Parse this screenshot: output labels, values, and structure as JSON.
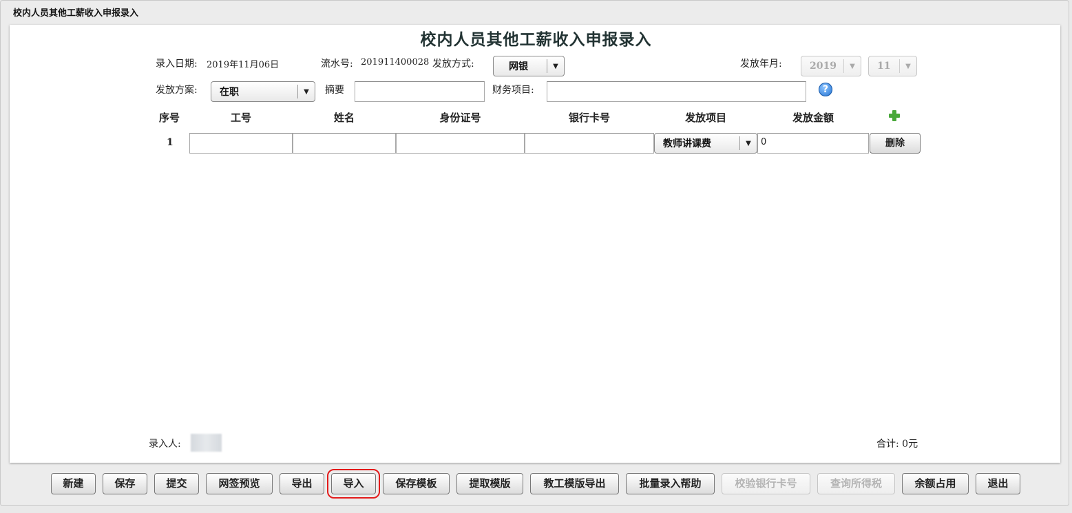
{
  "window": {
    "title": "校内人员其他工薪收入申报录入"
  },
  "page": {
    "title": "校内人员其他工薪收入申报录入"
  },
  "form": {
    "entry_date_label": "录入日期:",
    "entry_date_value": "2019年11月06日",
    "serial_label": "流水号:",
    "serial_value": "201911400028",
    "payment_method_label": "发放方式:",
    "payment_method_value": "网银",
    "pay_period_label": "发放年月:",
    "pay_year_value": "2019",
    "pay_month_value": "11",
    "plan_label": "发放方案:",
    "plan_value": "在职",
    "summary_label": "摘要",
    "summary_value": "",
    "finance_label": "财务项目:",
    "finance_value": ""
  },
  "table": {
    "headers": [
      "序号",
      "工号",
      "姓名",
      "身份证号",
      "银行卡号",
      "发放项目",
      "发放金额"
    ],
    "rows": [
      {
        "index": "1",
        "staff_id": "",
        "name": "",
        "id_card": "",
        "bank_card": "",
        "item": "教师讲课费",
        "amount": "0",
        "delete_label": "删除"
      }
    ]
  },
  "footer": {
    "entered_by_label": "录入人:",
    "total_label": "合计: 0元"
  },
  "toolbar": {
    "buttons": [
      "新建",
      "保存",
      "提交",
      "网签预览",
      "导出",
      "导入",
      "保存模板",
      "提取模版",
      "教工模版导出",
      "批量录入帮助",
      "校验银行卡号",
      "查询所得税",
      "余额占用",
      "退出"
    ],
    "disabled": [
      "校验银行卡号",
      "查询所得税"
    ],
    "highlighted": "导入"
  },
  "colors": {
    "highlight_outline": "#e31b1b",
    "add_icon": "#49a83a",
    "help_icon": "#1f6fd0"
  }
}
